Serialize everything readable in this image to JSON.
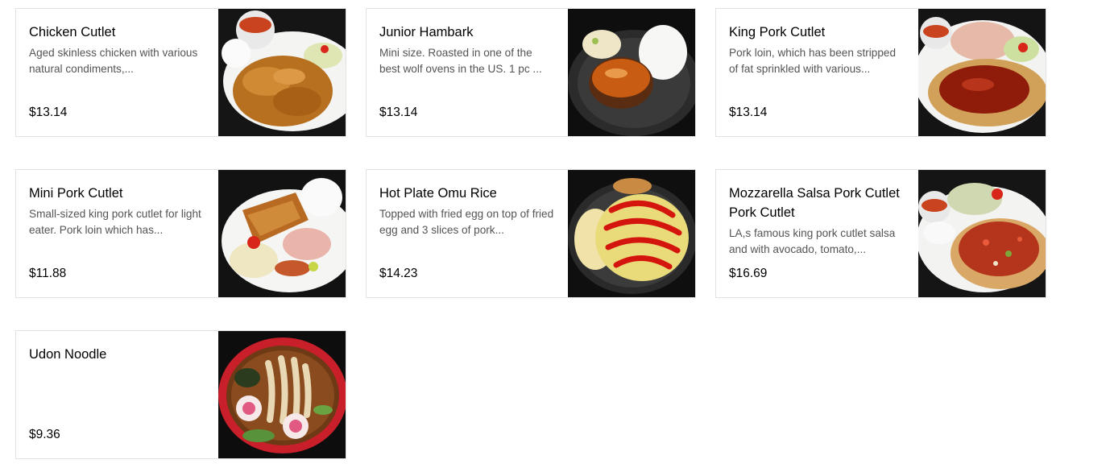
{
  "menu": {
    "items": [
      {
        "name": "Chicken Cutlet",
        "description": "Aged skinless chicken with various natural condiments,...",
        "price": "$13.14",
        "photo": "chicken-cutlet-plate"
      },
      {
        "name": "Junior Hambark",
        "description": "Mini size. Roasted in one of the best wolf ovens in the US. 1 pc ...",
        "price": "$13.14",
        "photo": "hamburg-steak-plate"
      },
      {
        "name": "King Pork Cutlet",
        "description": "Pork loin, which has been stripped of fat sprinkled with various...",
        "price": "$13.14",
        "photo": "pork-cutlet-plate"
      },
      {
        "name": "Mini Pork Cutlet",
        "description": "Small-sized king pork cutlet for light eater. Pork loin which has...",
        "price": "$11.88",
        "photo": "mini-pork-cutlet-plate"
      },
      {
        "name": "Hot Plate Omu Rice",
        "description": "Topped with fried egg on top of fried egg and 3 slices of pork...",
        "price": "$14.23",
        "photo": "omu-rice-plate"
      },
      {
        "name": "Mozzarella Salsa Pork Cutlet Pork Cutlet",
        "description": "LA,s famous king pork cutlet salsa and with avocado, tomato,...",
        "price": "$16.69",
        "photo": "salsa-pork-cutlet-plate"
      },
      {
        "name": "Udon Noodle",
        "description": "",
        "price": "$9.36",
        "photo": "udon-bowl"
      }
    ]
  }
}
